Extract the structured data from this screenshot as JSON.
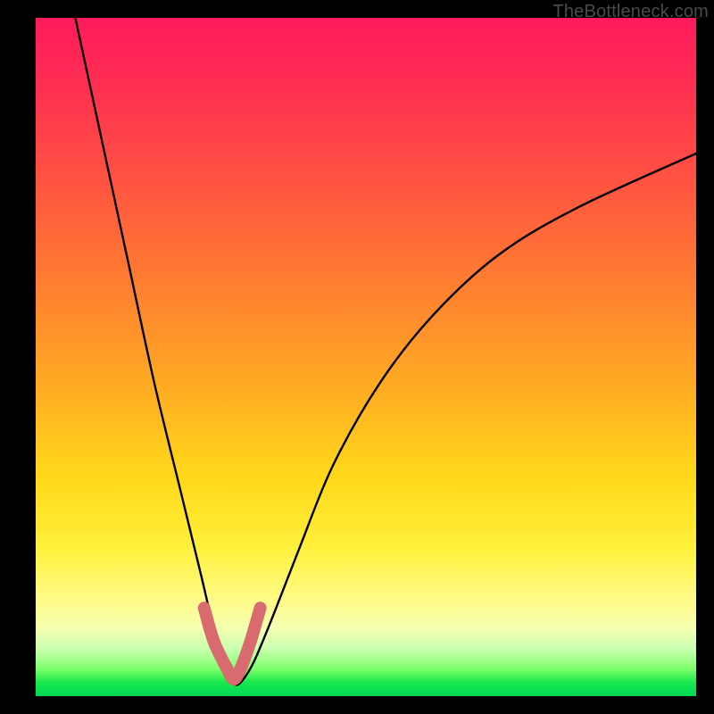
{
  "watermark": "TheBottleneck.com",
  "chart_data": {
    "type": "line",
    "title": "",
    "xlabel": "",
    "ylabel": "",
    "xlim": [
      0,
      100
    ],
    "ylim": [
      0,
      100
    ],
    "gradient_stops": [
      {
        "pos": 0,
        "color": "#ff1a5c"
      },
      {
        "pos": 25,
        "color": "#ff5640"
      },
      {
        "pos": 55,
        "color": "#ffad22"
      },
      {
        "pos": 78,
        "color": "#fff03a"
      },
      {
        "pos": 93,
        "color": "#caffb0"
      },
      {
        "pos": 100,
        "color": "#00d858"
      }
    ],
    "series": [
      {
        "name": "bottleneck-curve",
        "x": [
          6,
          10,
          14,
          18,
          22,
          25,
          27,
          29,
          30,
          31,
          33,
          36,
          40,
          45,
          52,
          60,
          70,
          82,
          100
        ],
        "values": [
          100,
          82,
          64,
          46,
          30,
          18,
          10,
          5,
          2,
          2,
          5,
          12,
          22,
          34,
          46,
          56,
          65,
          72,
          80
        ]
      }
    ],
    "highlight": {
      "name": "optimal-zone",
      "x": [
        25.5,
        27,
        29,
        30,
        31,
        32.5,
        34
      ],
      "values": [
        13,
        8,
        4,
        2.5,
        4,
        8,
        13
      ],
      "color": "#d96a6f",
      "stroke_width": 14
    }
  }
}
